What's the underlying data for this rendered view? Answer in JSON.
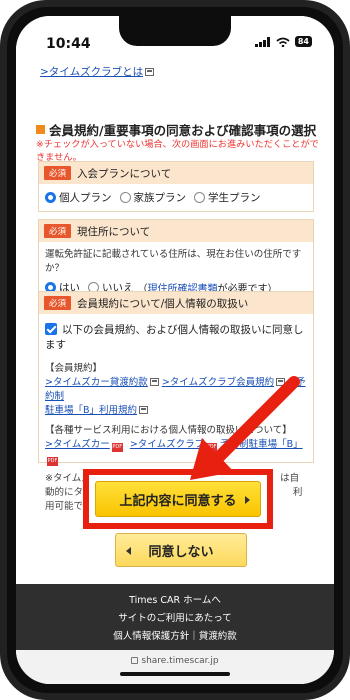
{
  "status": {
    "time": "10:44",
    "battery": "84"
  },
  "top_link": ">タイムズクラブとは",
  "section": {
    "title": "会員規約/重要事項の同意および確認事項の選択",
    "warning": "※チェックが入っていない場合、次の画面にお進みいただくことができません。"
  },
  "required_label": "必須",
  "plan": {
    "heading": "入会プランについて",
    "options": [
      "個人プラン",
      "家族プラン",
      "学生プラン"
    ],
    "selected": "個人プラン"
  },
  "address": {
    "heading": "現住所について",
    "question": "運転免許証に記載されている住所は、現在お住いの住所ですか？",
    "yes": "はい",
    "no": "いいえ",
    "note_pre": "（",
    "note_link": "現住所確認書類",
    "note_post": "が必要です）"
  },
  "terms": {
    "heading": "会員規約について/個人情報の取扱い",
    "agree_text": "以下の会員規約、および個人情報の取扱いに同意します",
    "group1_label": "【会員規約】",
    "group1_links": [
      ">タイムズカー貸渡約款",
      ">タイムズクラブ会員規約",
      ">予約制",
      "駐車場「B」利用規約"
    ],
    "group2_label": "【各種サービス利用における個人情報の取扱いについて】",
    "group2_links": [
      ">タイムズカー",
      ">タイムズクラブ",
      "予約制駐車場「B」"
    ],
    "note": "※タイムズカー貸渡約款に基づき、タイ　　　　　　　は自動的にタイムズクラブ会員となり、予約制駐車場「B」　　利用可能です。"
  },
  "buttons": {
    "agree": "上記内容に同意する",
    "disagree": "同意しない"
  },
  "footer": {
    "line1": "Times CAR ホームへ",
    "line2": "サイトのご利用にあたって",
    "line3": "個人情報保護方針｜貸渡約款"
  },
  "url": "share.timescar.jp",
  "colors": {
    "accent_red": "#e8200f",
    "button_yellow": "#f9c400",
    "link_blue": "#1a4fb5"
  }
}
